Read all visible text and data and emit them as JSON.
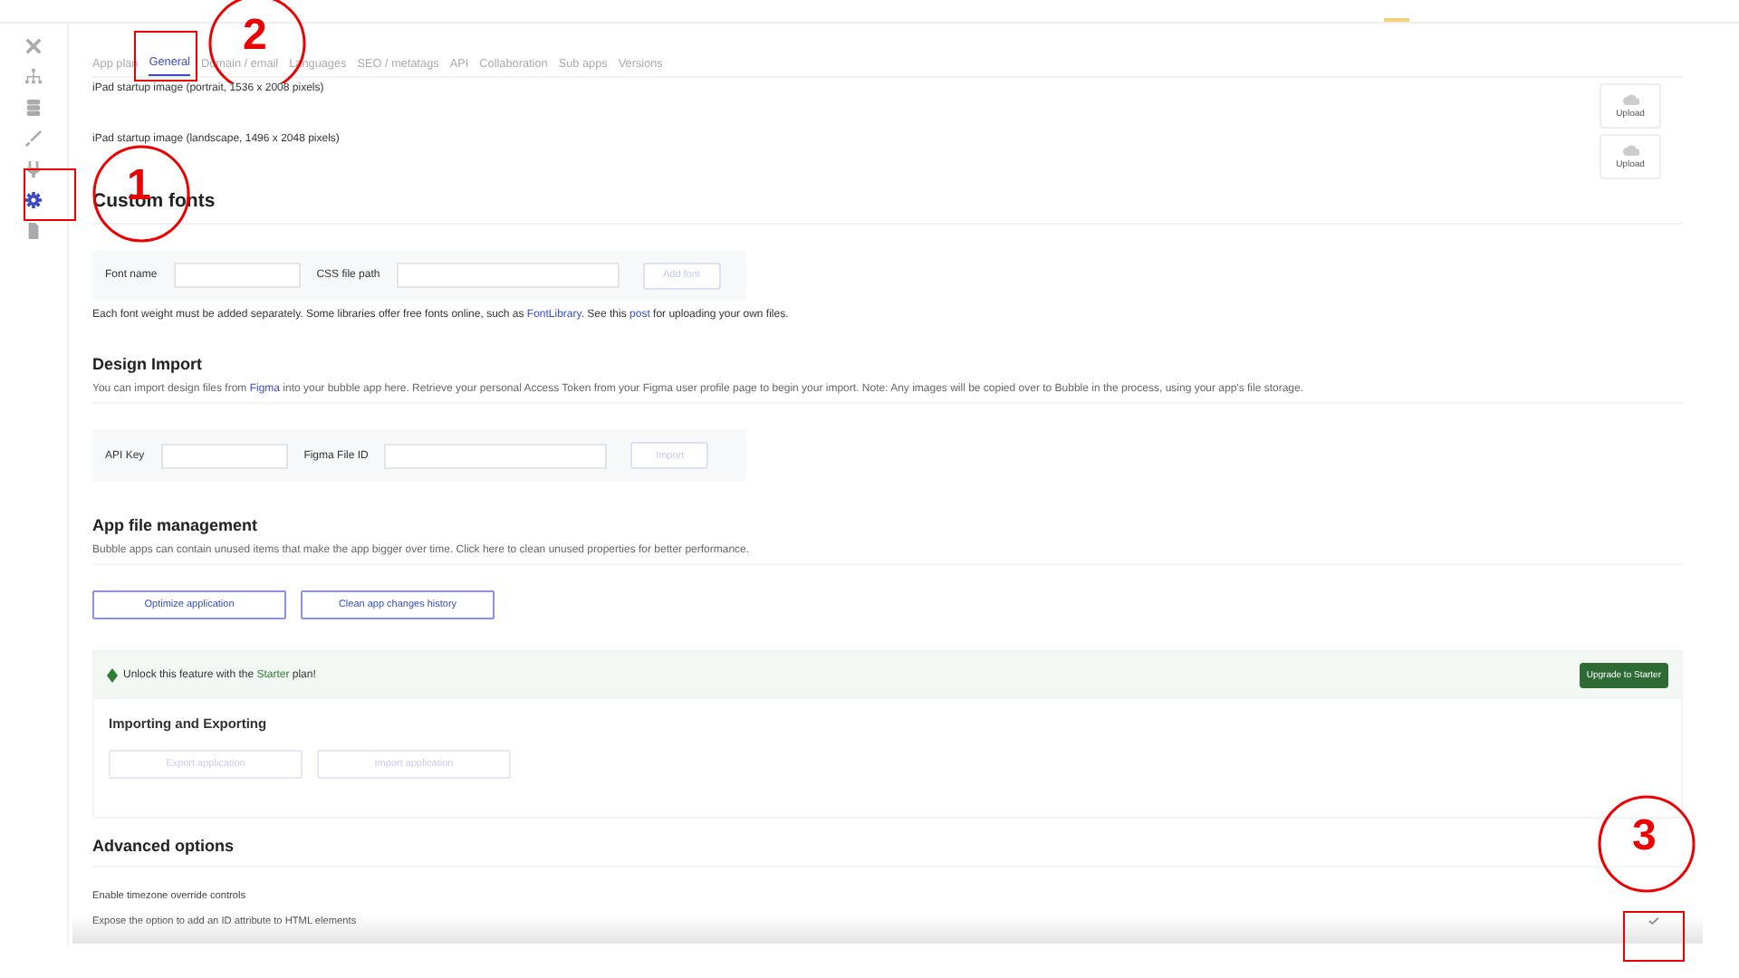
{
  "sidebar": {
    "items": [
      {
        "selected": false
      },
      {
        "selected": false
      },
      {
        "selected": false
      },
      {
        "selected": false
      },
      {
        "selected": false
      },
      {
        "selected": true
      },
      {
        "selected": false
      }
    ]
  },
  "tabs": [
    {
      "label": "App plan",
      "selected": false
    },
    {
      "label": "General",
      "selected": true
    },
    {
      "label": "Domain / email",
      "selected": false
    },
    {
      "label": "Languages",
      "selected": false
    },
    {
      "label": "SEO / metatags",
      "selected": false
    },
    {
      "label": "API",
      "selected": false
    },
    {
      "label": "Collaboration",
      "selected": false
    },
    {
      "label": "Sub apps",
      "selected": false
    },
    {
      "label": "Versions",
      "selected": false
    }
  ],
  "uploads": [
    {
      "label": "iPad startup image (portrait, 1536 x 2008 pixels)",
      "button": "Upload"
    },
    {
      "label": "iPad startup image (landscape, 1496 x 2048 pixels)",
      "button": "Upload"
    }
  ],
  "custom_fonts": {
    "title": "Custom fonts",
    "fields": [
      {
        "label": "Font name"
      },
      {
        "label": "CSS file path"
      }
    ],
    "button": "Add font",
    "note": [
      {
        "text": "Each font weight must be added separately. Some libraries offer free fonts online, such as "
      },
      {
        "link": "FontLibrary"
      },
      {
        "text": ". See this "
      },
      {
        "link": "post"
      },
      {
        "text": " for uploading your own files."
      }
    ]
  },
  "design_import": {
    "title": "Design Import",
    "text": [
      {
        "text": "You can import design files from "
      },
      {
        "link": "Figma"
      },
      {
        "text": " into your bubble app here. Retrieve your personal Access Token from your Figma user profile page to begin your import. Note: Any images will be copied over to Bubble in the process, using your app's file storage."
      }
    ],
    "fields": [
      {
        "label": "API Key"
      },
      {
        "label": "Figma File ID"
      }
    ],
    "button": "Import"
  },
  "app_file_management": {
    "title": "App file management",
    "text": "Bubble apps can contain unused items that make the app bigger over time. Click here to clean unused properties for better performance.",
    "buttons": [
      "Optimize application",
      "Clean app changes history"
    ]
  },
  "upgrade_banner": {
    "text_before": "Unlock this feature with the",
    "plan": "Starter",
    "text_after": "plan!",
    "button": "Upgrade to Starter"
  },
  "importing_exporting": {
    "title": "Importing and Exporting",
    "buttons": [
      {
        "label": "Export application",
        "disabled": true
      },
      {
        "label": "Import application",
        "disabled": true
      }
    ]
  },
  "advanced_options": {
    "title": "Advanced options",
    "options": [
      {
        "label": "Enable timezone override controls"
      },
      {
        "label": "Expose the option to add an ID attribute to HTML elements",
        "checked": true
      }
    ]
  },
  "annotations": [
    {
      "label": "1"
    },
    {
      "label": "2"
    },
    {
      "label": "3"
    }
  ]
}
